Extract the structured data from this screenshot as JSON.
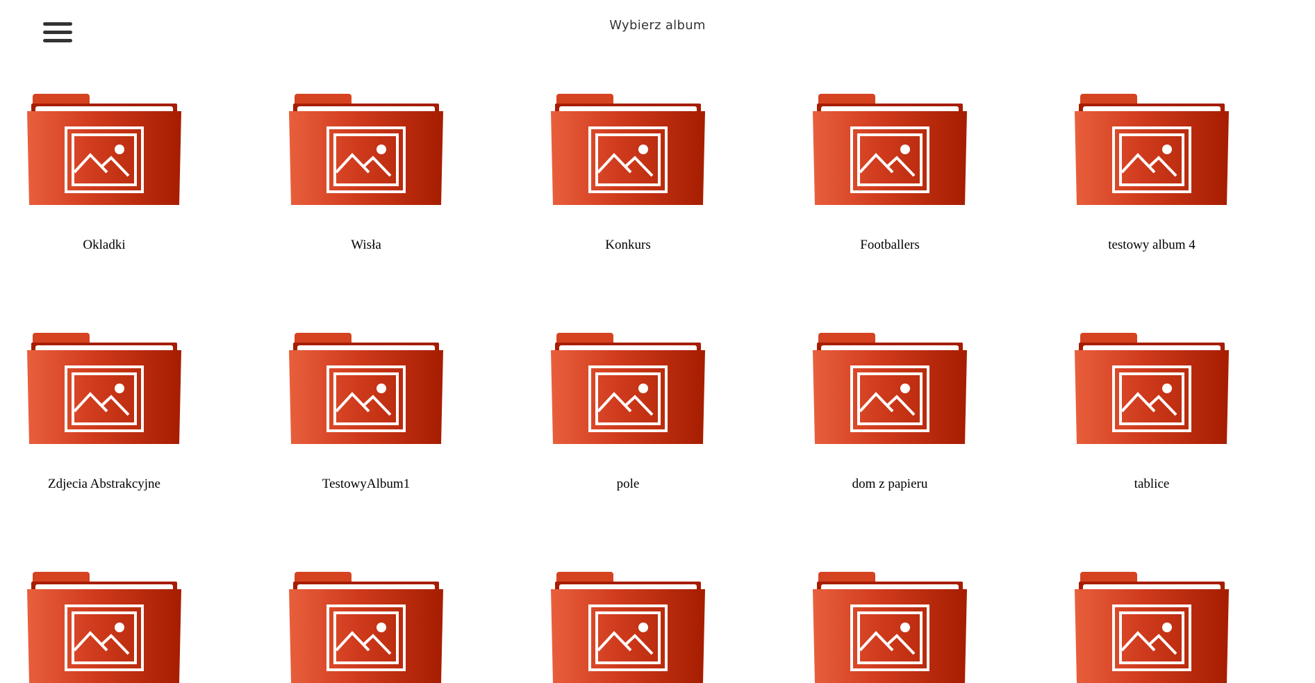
{
  "header": {
    "title": "Wybierz album",
    "menu_icon": "hamburger-menu-icon"
  },
  "colors": {
    "folder_light": "#e85f3c",
    "folder_dark": "#a61d00",
    "folder_tab": "#d64321",
    "paper": "#ffffff"
  },
  "albums": [
    {
      "label": "Okladki",
      "icon": "image-folder-icon"
    },
    {
      "label": "Wisła",
      "icon": "image-folder-icon"
    },
    {
      "label": "Konkurs",
      "icon": "image-folder-icon"
    },
    {
      "label": "Footballers",
      "icon": "image-folder-icon"
    },
    {
      "label": "testowy album 4",
      "icon": "image-folder-icon"
    },
    {
      "label": "Zdjecia Abstrakcyjne",
      "icon": "image-folder-icon"
    },
    {
      "label": "TestowyAlbum1",
      "icon": "image-folder-icon"
    },
    {
      "label": "pole",
      "icon": "image-folder-icon"
    },
    {
      "label": "dom z papieru",
      "icon": "image-folder-icon"
    },
    {
      "label": "tablice",
      "icon": "image-folder-icon"
    },
    {
      "label": "",
      "icon": "image-folder-icon"
    },
    {
      "label": "",
      "icon": "image-folder-icon"
    },
    {
      "label": "",
      "icon": "image-folder-icon"
    },
    {
      "label": "",
      "icon": "image-folder-icon"
    },
    {
      "label": "",
      "icon": "image-folder-icon"
    }
  ]
}
